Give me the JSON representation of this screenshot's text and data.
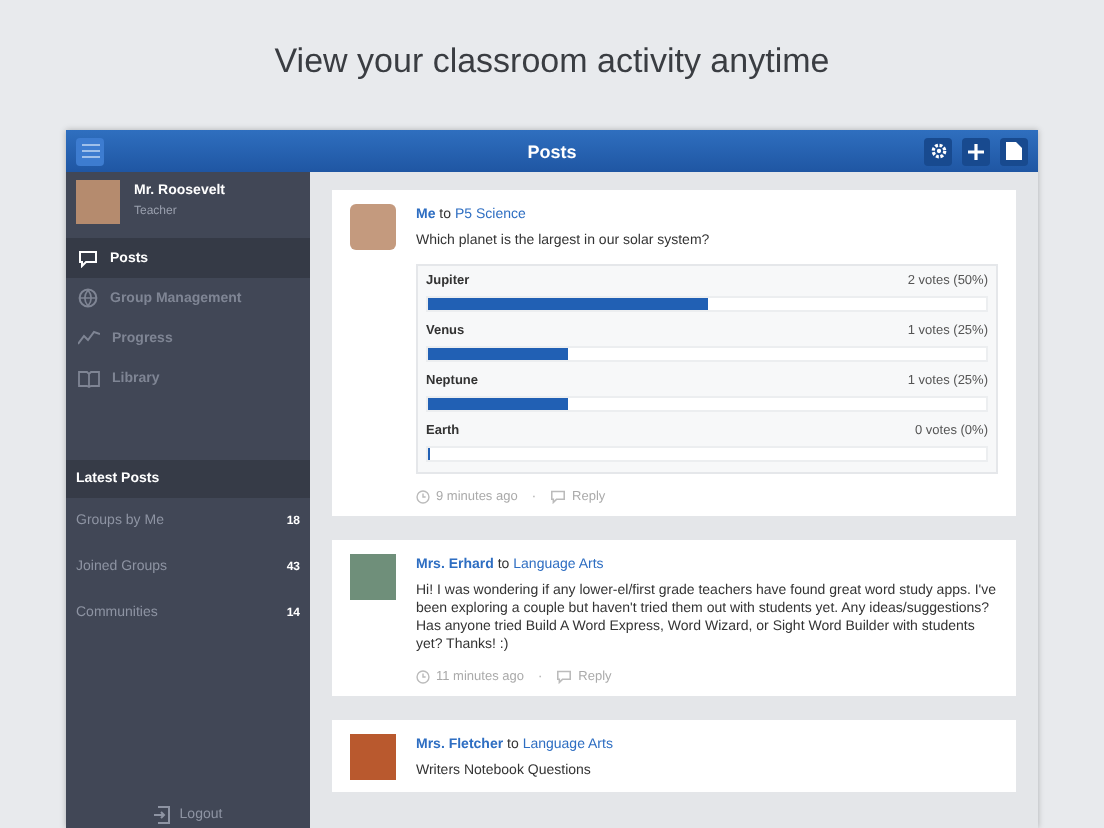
{
  "caption": "View your classroom activity anytime",
  "header": {
    "title": "Posts"
  },
  "profile": {
    "name": "Mr. Roosevelt",
    "role": "Teacher"
  },
  "nav": [
    {
      "label": "Posts",
      "kind": "comment",
      "selected": true
    },
    {
      "label": "Group Management",
      "kind": "globe",
      "selected": false
    },
    {
      "label": "Progress",
      "kind": "chart",
      "selected": false
    },
    {
      "label": "Library",
      "kind": "book",
      "selected": false
    }
  ],
  "latest_posts": {
    "title": "Latest Posts",
    "items": [
      {
        "label": "Groups by Me",
        "count": "18"
      },
      {
        "label": "Joined Groups",
        "count": "43"
      },
      {
        "label": "Communities",
        "count": "14"
      }
    ]
  },
  "logout": "Logout",
  "posts": [
    {
      "kind": "poll",
      "author": "Me",
      "connector": "to",
      "group": "P5 Science",
      "text": "Which planet is the largest in our solar system?",
      "options": [
        {
          "label": "Jupiter",
          "votes": "2 votes (50%)",
          "level": 0.5
        },
        {
          "label": "Venus",
          "votes": "1 votes (25%)",
          "level": 0.25
        },
        {
          "label": "Neptune",
          "votes": "1 votes (25%)",
          "level": 0.25
        },
        {
          "label": "Earth",
          "votes": "0 votes (0%)",
          "level": 0
        }
      ],
      "time": "9 minutes ago",
      "separator": "·",
      "reply": "Reply"
    },
    {
      "kind": "text",
      "author": "Mrs. Erhard",
      "connector": "to",
      "group": "Language Arts",
      "text": "Hi!  I was wondering if any lower-el/first grade teachers have found great word study apps.  I've been exploring a couple but haven't tried them out with students yet.  Any ideas/suggestions?  Has anyone tried Build A Word Express, Word Wizard, or Sight Word Builder with students yet?  Thanks!  :)",
      "time": "11 minutes ago",
      "separator": "·",
      "reply": "Reply"
    },
    {
      "kind": "text",
      "author": "Mrs. Fletcher",
      "connector": "to",
      "group": "Language Arts",
      "text": "Writers Notebook Questions"
    }
  ]
}
